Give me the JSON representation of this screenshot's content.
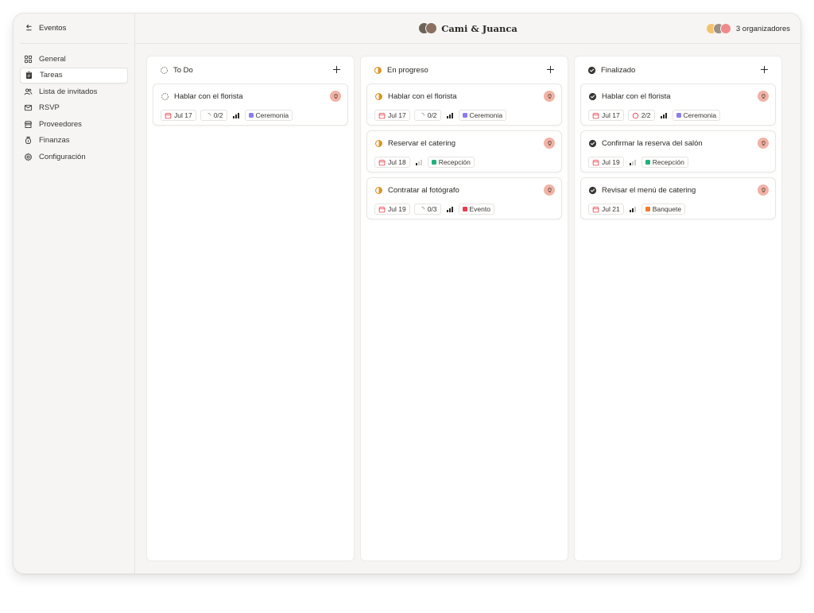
{
  "sidebar": {
    "back_label": "Eventos",
    "items": [
      {
        "label": "General",
        "icon": "grid-icon"
      },
      {
        "label": "Tareas",
        "icon": "clipboard-icon",
        "active": true
      },
      {
        "label": "Lista de invitados",
        "icon": "users-icon"
      },
      {
        "label": "RSVP",
        "icon": "mail-reply-icon"
      },
      {
        "label": "Proveedores",
        "icon": "store-icon"
      },
      {
        "label": "Finanzas",
        "icon": "money-bag-icon"
      },
      {
        "label": "Configuración",
        "icon": "gear-icon"
      }
    ]
  },
  "header": {
    "title": "Cami & Juanca",
    "organizers_label": "3 organizadores"
  },
  "columns": [
    {
      "title": "To Do",
      "status": "todo",
      "cards": [
        {
          "title": "Hablar con el florista",
          "date": "Jul 17",
          "subtasks": "0/2",
          "tag": "Ceremonia",
          "tag_color": "#8b7cf0",
          "priority": 3
        }
      ]
    },
    {
      "title": "En progreso",
      "status": "progress",
      "cards": [
        {
          "title": "Hablar con el florista",
          "date": "Jul 17",
          "subtasks": "0/2",
          "tag": "Ceremonia",
          "tag_color": "#8b7cf0",
          "priority": 3
        },
        {
          "title": "Reservar el catering",
          "date": "Jul 18",
          "subtasks": null,
          "tag": "Recepción",
          "tag_color": "#22b07d",
          "priority": 1
        },
        {
          "title": "Contratar al fotógrafo",
          "date": "Jul 19",
          "subtasks": "0/3",
          "tag": "Evento",
          "tag_color": "#ea3d4f",
          "priority": 3
        }
      ]
    },
    {
      "title": "Finalizado",
      "status": "done",
      "cards": [
        {
          "title": "Hablar con el florista",
          "date": "Jul 17",
          "subtasks": "2/2",
          "tag": "Ceremonia",
          "tag_color": "#8b7cf0",
          "priority": 3
        },
        {
          "title": "Confirmar la reserva del salón",
          "date": "Jul 19",
          "subtasks": null,
          "tag": "Recepción",
          "tag_color": "#22b07d",
          "priority": 1
        },
        {
          "title": "Revisar el menú de catering",
          "date": "Jul 21",
          "subtasks": null,
          "tag": "Banquete",
          "tag_color": "#f07a2a",
          "priority": 2
        }
      ]
    }
  ],
  "colors": {
    "calendar": "#e8434f",
    "progress_icon": "#d9962b",
    "done_icon": "#3a3733",
    "assignee_bg": "#f0b3a6"
  }
}
